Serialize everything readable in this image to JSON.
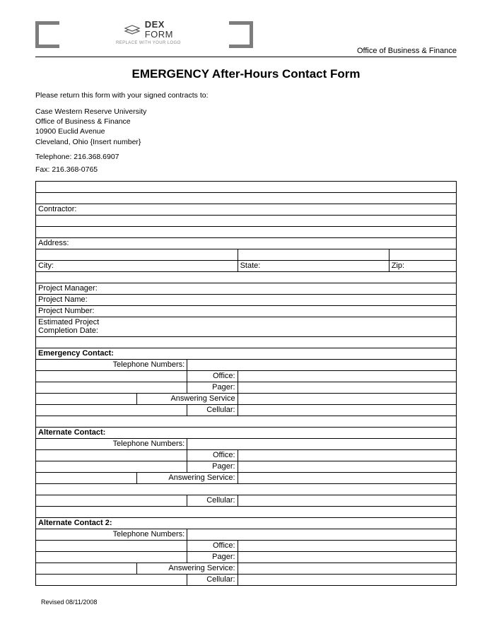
{
  "header": {
    "logo_dex": "DEX",
    "logo_form": "FORM",
    "logo_sub": "REPLACE WITH YOUR LOGO",
    "office_label": "Office of Business & Finance"
  },
  "title": "EMERGENCY After-Hours Contact Form",
  "intro": "Please return this form with your signed contracts to:",
  "address": {
    "line1": "Case Western Reserve University",
    "line2": "Office of Business & Finance",
    "line3": "10900 Euclid Avenue",
    "line4": "Cleveland, Ohio {Insert number}"
  },
  "telephone": "Telephone: 216.368.6907",
  "fax": "Fax: 216.368-0765",
  "fields": {
    "contractor": "Contractor:",
    "address": "Address:",
    "city": "City:",
    "state": "State:",
    "zip": "Zip:",
    "project_manager": "Project Manager:",
    "project_name": "Project Name:",
    "project_number": "Project Number:",
    "est_completion_l1": "Estimated Project",
    "est_completion_l2": "Completion Date:"
  },
  "contact_sections": {
    "emergency": "Emergency Contact:",
    "alternate": "Alternate Contact:",
    "alternate2": "Alternate Contact 2:",
    "telephone_numbers": "Telephone Numbers:",
    "office": "Office:",
    "pager": "Pager:",
    "answering": "Answering Service",
    "answering_colon": "Answering Service:",
    "cellular": "Cellular:"
  },
  "revised": "Revised 08/11/2008"
}
